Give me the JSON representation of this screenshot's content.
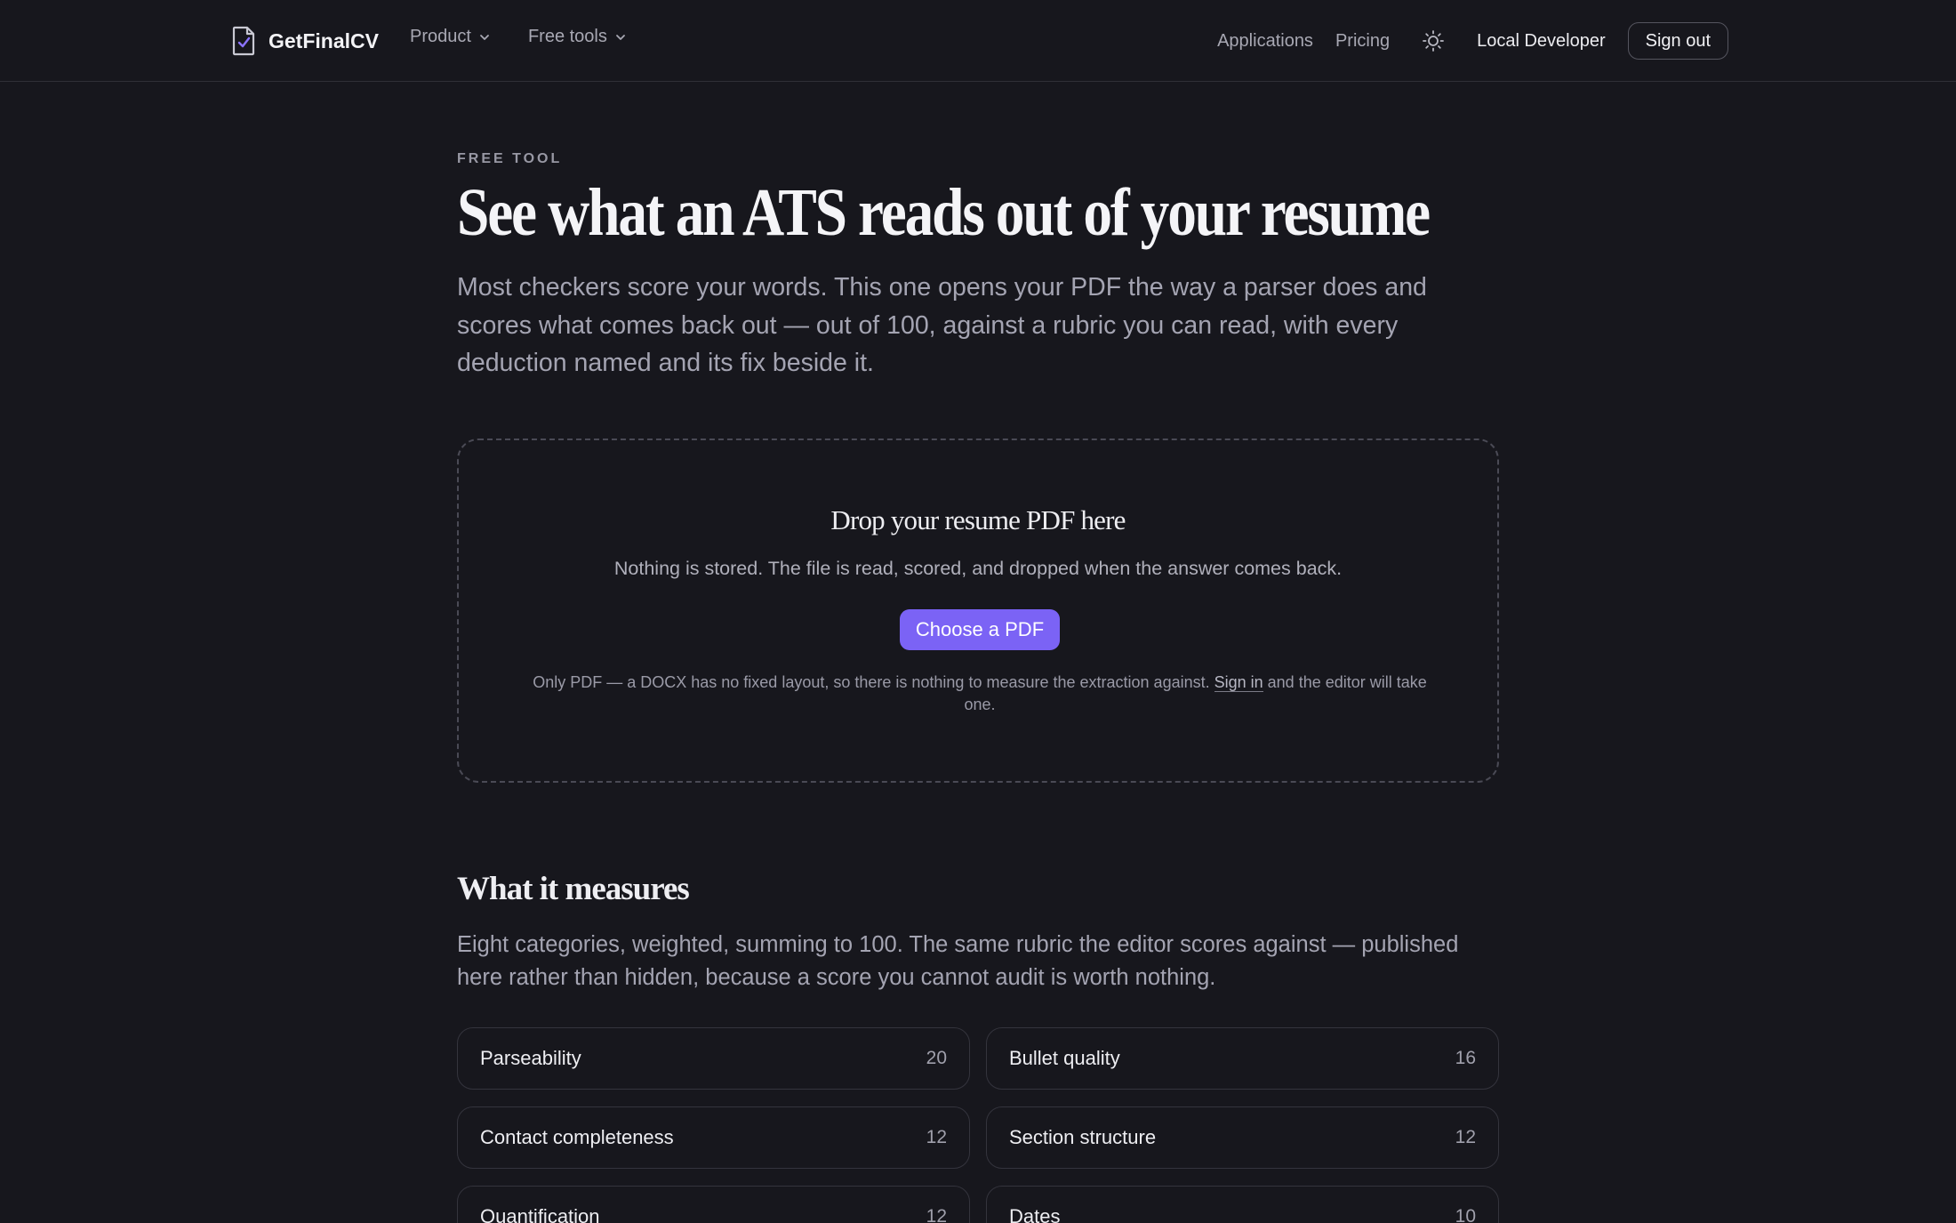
{
  "brand": {
    "name": "GetFinalCV",
    "icon": "document-check-icon"
  },
  "nav": {
    "product": "Product",
    "free_tools": "Free tools",
    "applications": "Applications",
    "pricing": "Pricing",
    "theme_icon": "sun-icon",
    "user": "Local Developer",
    "sign_out": "Sign out"
  },
  "hero": {
    "eyebrow": "FREE TOOL",
    "title": "See what an ATS reads out of your resume",
    "subtitle": "Most checkers score your words. This one opens your PDF the way a parser does and scores what comes back out — out of 100, against a rubric you can read, with every deduction named and its fix beside it."
  },
  "dropzone": {
    "title": "Drop your resume PDF here",
    "note": "Nothing is stored. The file is read, scored, and dropped when the answer comes back.",
    "button": "Choose a PDF",
    "footer_before": "Only PDF — a DOCX has no fixed layout, so there is nothing to measure the extraction against. ",
    "footer_link": "Sign in",
    "footer_after": " and the editor will take one."
  },
  "measures": {
    "title": "What it measures",
    "subtitle": "Eight categories, weighted, summing to 100. The same rubric the editor scores against — published here rather than hidden, because a score you cannot audit is worth nothing.",
    "categories": [
      {
        "name": "Parseability",
        "weight": "20"
      },
      {
        "name": "Bullet quality",
        "weight": "16"
      },
      {
        "name": "Contact completeness",
        "weight": "12"
      },
      {
        "name": "Section structure",
        "weight": "12"
      },
      {
        "name": "Quantification",
        "weight": "12"
      },
      {
        "name": "Dates",
        "weight": "10"
      }
    ]
  },
  "colors": {
    "background": "#17171d",
    "accent": "#7b63f5",
    "text": "#e9e9ee",
    "muted": "#a4a4b2"
  }
}
